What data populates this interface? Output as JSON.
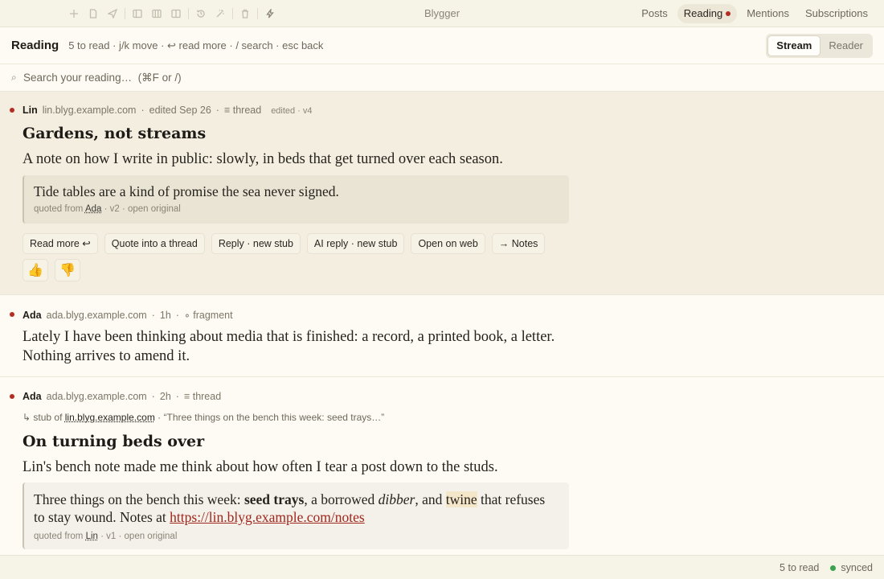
{
  "app": {
    "title": "Blygger"
  },
  "nav": {
    "posts": "Posts",
    "reading": "Reading",
    "mentions": "Mentions",
    "subscriptions": "Subscriptions"
  },
  "header": {
    "title": "Reading",
    "hints": "5 to read · j/k move · ↩ read more · / search · esc back",
    "view_stream": "Stream",
    "view_reader": "Reader"
  },
  "search": {
    "placeholder": "Search your reading…  (⌘F or /)"
  },
  "posts": [
    {
      "author": "Lin",
      "domain": "lin.blyg.example.com",
      "time": "edited Sep 26",
      "kind": "≡ thread",
      "version": "edited · v4",
      "title": "Gardens, not streams",
      "body": "A note on how I write in public: slowly, in beds that get turned over each season.",
      "quote": {
        "text": "Tide tables are a kind of promise the sea never signed.",
        "prefix": "quoted from",
        "source": "Ada",
        "suffix": "· v2 · open original"
      },
      "actions": [
        "Read more ↩",
        "Quote into a thread",
        "Reply · new stub",
        "AI reply · new stub",
        "Open on web",
        "→ Notes"
      ],
      "reactions": {
        "up": "👍",
        "down": "👎"
      }
    },
    {
      "author": "Ada",
      "domain": "ada.blyg.example.com",
      "time": "1h",
      "kind": "∘ fragment",
      "body": "Lately I have been thinking about media that is finished: a record, a printed book, a letter. Nothing arrives to amend it."
    },
    {
      "author": "Ada",
      "domain": "ada.blyg.example.com",
      "time": "2h",
      "kind": "≡ thread",
      "stub_prefix": "↳ stub of",
      "stub_link": "lin.blyg.example.com",
      "stub_excerpt": "· “Three things on the bench this week: seed trays…”",
      "title": "On turning beds over",
      "body": "Lin's bench note made me think about how often I tear a post down to the studs.",
      "quote": {
        "t1": "Three things on the bench this week: ",
        "bold": "seed trays",
        "t2": ", a borrowed ",
        "italic": "dibber",
        "t3": ", and ",
        "highlight": "twine",
        "t4": " that refuses to stay wound. Notes at ",
        "url": "https://lin.blyg.example.com/notes",
        "prefix": "quoted from",
        "source": "Lin",
        "suffix": "· v1 · open original"
      }
    }
  ],
  "footer": {
    "count": "5 to read",
    "status": "synced"
  },
  "colors": {
    "accent": "#b32d22",
    "synced": "#3aa350",
    "selected_bg": "#f3eedf"
  }
}
